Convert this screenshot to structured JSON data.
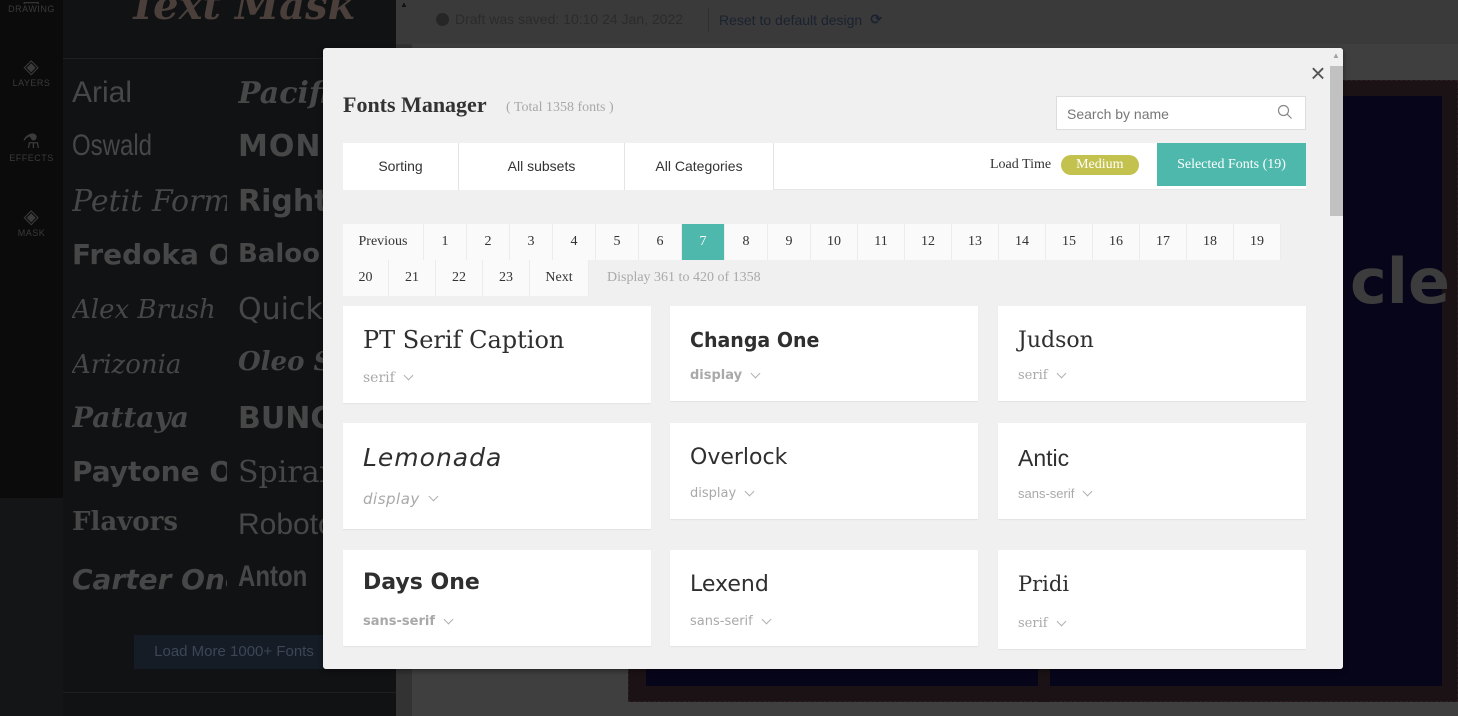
{
  "rail": {
    "items": [
      {
        "label": "DRAWING",
        "icon": "pencil-icon"
      },
      {
        "label": "LAYERS",
        "icon": "layers-icon"
      },
      {
        "label": "EFFECTS",
        "icon": "flask-icon"
      },
      {
        "label": "MASK",
        "icon": "layers-icon"
      }
    ]
  },
  "font_panel": {
    "logo_text": "Text Mask",
    "fonts_col1": [
      "Arial",
      "Oswald",
      "Petit Form",
      "Fredoka One",
      "Alex Brush",
      "Arizonia",
      "Pattaya",
      "Paytone One",
      "Flavors",
      "Carter One"
    ],
    "fonts_col2": [
      "Pacifico",
      "Monoton",
      "Righteous",
      "Baloo",
      "Quicksand",
      "Oleo Script",
      "Bungee",
      "Spirax",
      "Roboto",
      "Anton"
    ],
    "load_more_label": "Load More 1000+ Fonts"
  },
  "topbar": {
    "draft_status": "Draft was saved: 10:10 24 Jan, 2022",
    "reset_label": "Reset to default design",
    "reset_icon": "refresh-icon"
  },
  "canvas": {
    "visible_text": "cle"
  },
  "modal": {
    "title": "Fonts Manager",
    "subtitle": "( Total 1358 fonts )",
    "close_icon": "close-icon",
    "search": {
      "placeholder": "Search by name",
      "value": "",
      "icon": "search-icon"
    },
    "toolbar": {
      "sorting_label": "Sorting",
      "subsets_label": "All subsets",
      "categories_label": "All Categories",
      "load_time_label": "Load Time",
      "load_time_value": "Medium",
      "selected_fonts_label": "Selected Fonts (19)"
    },
    "pagination": {
      "previous_label": "Previous",
      "next_label": "Next",
      "pages": [
        "1",
        "2",
        "3",
        "4",
        "5",
        "6",
        "7",
        "8",
        "9",
        "10",
        "11",
        "12",
        "13",
        "14",
        "15",
        "16",
        "17",
        "18",
        "19",
        "20",
        "21",
        "22",
        "23"
      ],
      "current_page": "7",
      "display_info": "Display 361 to 420 of 1358"
    },
    "fonts": [
      {
        "name": "PT Serif Caption",
        "category": "serif"
      },
      {
        "name": "Changa One",
        "category": "display"
      },
      {
        "name": "Judson",
        "category": "serif"
      },
      {
        "name": "Lemonada",
        "category": "display"
      },
      {
        "name": "Overlock",
        "category": "display"
      },
      {
        "name": "Antic",
        "category": "sans-serif"
      },
      {
        "name": "Days One",
        "category": "sans-serif"
      },
      {
        "name": "Lexend",
        "category": "sans-serif"
      },
      {
        "name": "Pridi",
        "category": "serif"
      }
    ]
  },
  "colors": {
    "accent": "#4fb8ad",
    "load_time_pill": "#c4c24e",
    "modal_bg": "#f0f0f0"
  }
}
